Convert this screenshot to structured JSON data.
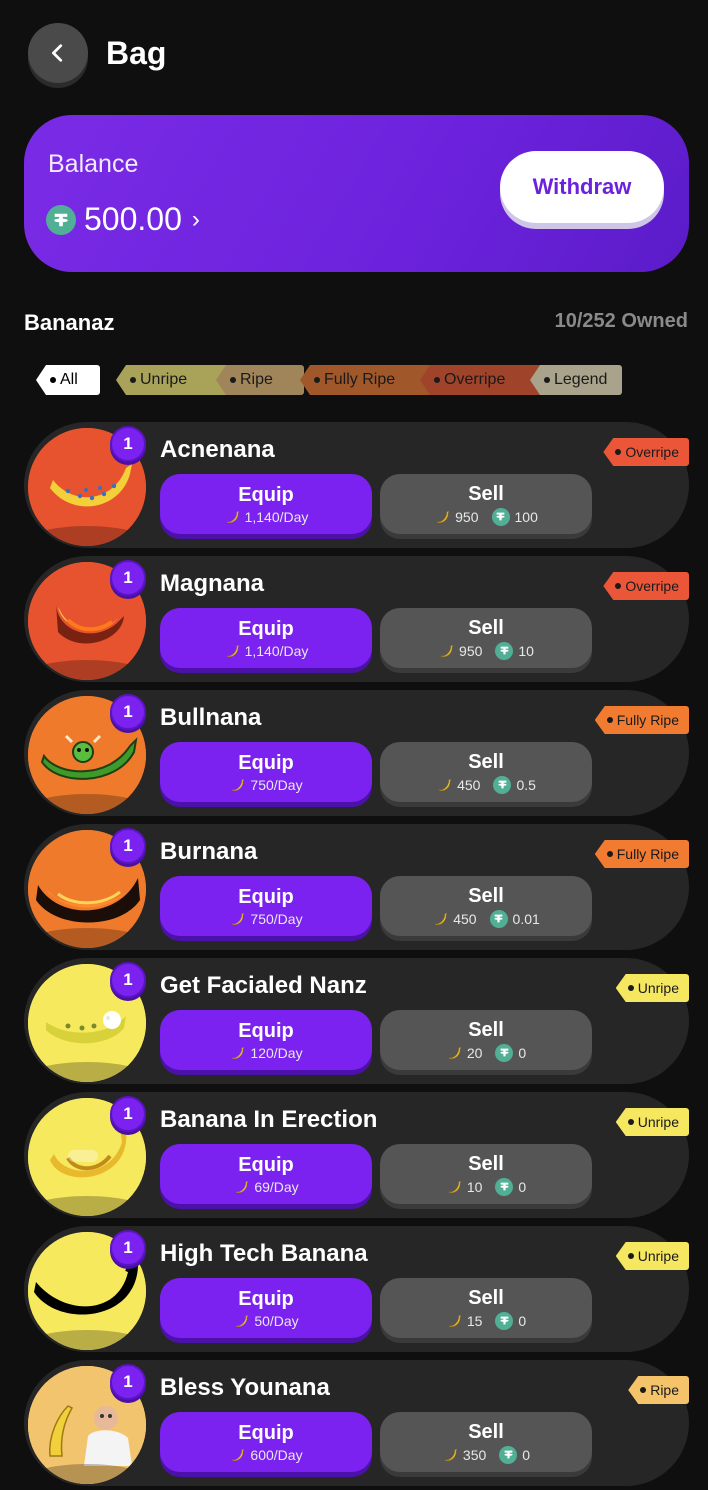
{
  "header": {
    "title": "Bag"
  },
  "balance": {
    "label": "Balance",
    "value": "500.00",
    "withdraw_label": "Withdraw"
  },
  "section": {
    "title": "Bananaz",
    "owned": "10/252 Owned"
  },
  "filters": [
    {
      "label": "All",
      "color": "#ffffff"
    },
    {
      "label": "Unripe",
      "color": "#a9a35a"
    },
    {
      "label": "Ripe",
      "color": "#a0855a"
    },
    {
      "label": "Fully Ripe",
      "color": "#a0582a"
    },
    {
      "label": "Overripe",
      "color": "#a0432b"
    },
    {
      "label": "Legend",
      "color": "#a8a38a"
    }
  ],
  "items": [
    {
      "name": "Acnenana",
      "qty": "1",
      "tier": "Overripe",
      "tier_color": "#ec5638",
      "bg": "#e8532f",
      "banana_icon": "acne-banana-icon",
      "equip_label": "Equip",
      "rate": "1,140/Day",
      "sell_label": "Sell",
      "sell_bananas": "950",
      "sell_usdt": "100"
    },
    {
      "name": "Magnana",
      "qty": "1",
      "tier": "Overripe",
      "tier_color": "#ec5638",
      "bg": "#e8532f",
      "banana_icon": "magma-banana-icon",
      "equip_label": "Equip",
      "rate": "1,140/Day",
      "sell_label": "Sell",
      "sell_bananas": "950",
      "sell_usdt": "10"
    },
    {
      "name": "Bullnana",
      "qty": "1",
      "tier": "Fully Ripe",
      "tier_color": "#f07b31",
      "bg": "#ef7a2c",
      "banana_icon": "bull-banana-icon",
      "equip_label": "Equip",
      "rate": "750/Day",
      "sell_label": "Sell",
      "sell_bananas": "450",
      "sell_usdt": "0.5"
    },
    {
      "name": "Burnana",
      "qty": "1",
      "tier": "Fully Ripe",
      "tier_color": "#f07b31",
      "bg": "#ef7a2c",
      "banana_icon": "burning-banana-icon",
      "equip_label": "Equip",
      "rate": "750/Day",
      "sell_label": "Sell",
      "sell_bananas": "450",
      "sell_usdt": "0.01"
    },
    {
      "name": "Get Facialed Nanz",
      "qty": "1",
      "tier": "Unripe",
      "tier_color": "#f6e761",
      "bg": "#f6e95d",
      "banana_icon": "facial-banana-icon",
      "equip_label": "Equip",
      "rate": "120/Day",
      "sell_label": "Sell",
      "sell_bananas": "20",
      "sell_usdt": "0"
    },
    {
      "name": "Banana In Erection",
      "qty": "1",
      "tier": "Unripe",
      "tier_color": "#f6e761",
      "bg": "#f6e95d",
      "banana_icon": "erect-banana-icon",
      "equip_label": "Equip",
      "rate": "69/Day",
      "sell_label": "Sell",
      "sell_bananas": "10",
      "sell_usdt": "0"
    },
    {
      "name": "High Tech Banana",
      "qty": "1",
      "tier": "Unripe",
      "tier_color": "#f6e761",
      "bg": "#f6e95d",
      "banana_icon": "tech-banana-icon",
      "equip_label": "Equip",
      "rate": "50/Day",
      "sell_label": "Sell",
      "sell_bananas": "15",
      "sell_usdt": "0"
    },
    {
      "name": "Bless Younana",
      "qty": "1",
      "tier": "Ripe",
      "tier_color": "#f5c36a",
      "bg": "#f5c46a",
      "banana_icon": "bless-banana-icon",
      "equip_label": "Equip",
      "rate": "600/Day",
      "sell_label": "Sell",
      "sell_bananas": "350",
      "sell_usdt": "0"
    }
  ]
}
